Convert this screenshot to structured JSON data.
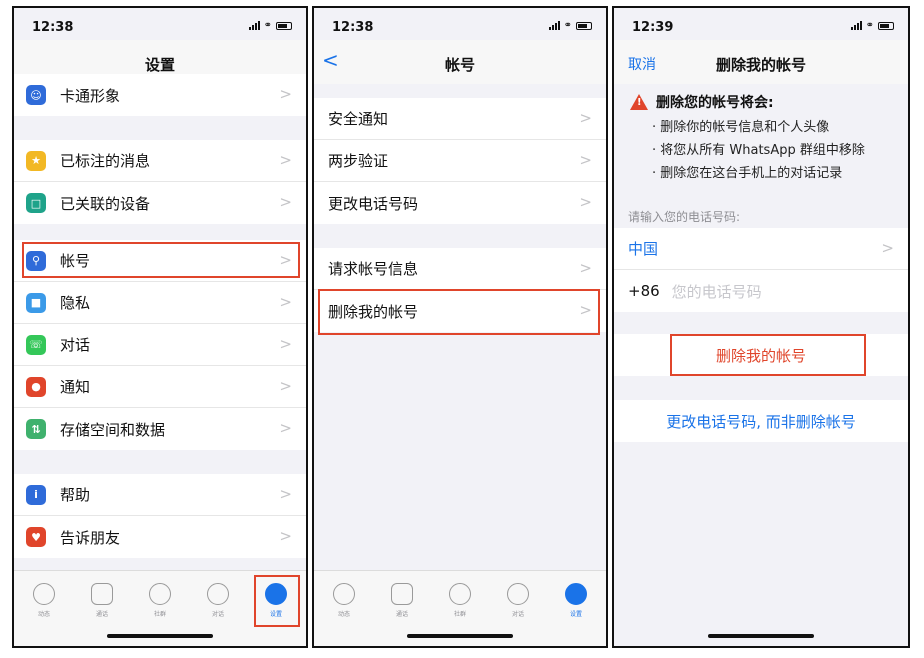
{
  "panel1": {
    "time": "12:38",
    "title": "设置",
    "groups": [
      [
        {
          "label": "卡通形象",
          "icon": "avatar-icon",
          "color": "#2f6bd9"
        }
      ],
      [
        {
          "label": "已标注的消息",
          "icon": "star-icon",
          "color": "#f2b824"
        },
        {
          "label": "已关联的设备",
          "icon": "laptop-icon",
          "color": "#1fa38a"
        }
      ],
      [
        {
          "label": "帐号",
          "icon": "key-icon",
          "color": "#2f6bd9"
        },
        {
          "label": "隐私",
          "icon": "lock-icon",
          "color": "#3b9ae8"
        },
        {
          "label": "对话",
          "icon": "whatsapp-icon",
          "color": "#34c759"
        },
        {
          "label": "通知",
          "icon": "notification-icon",
          "color": "#e0452b"
        },
        {
          "label": "存储空间和数据",
          "icon": "storage-icon",
          "color": "#3fb16d"
        }
      ],
      [
        {
          "label": "帮助",
          "icon": "info-icon",
          "color": "#2f6bd9"
        },
        {
          "label": "告诉朋友",
          "icon": "heart-icon",
          "color": "#e0452b"
        }
      ]
    ],
    "tabs": [
      "动态",
      "通话",
      "社群",
      "对话",
      "设置"
    ]
  },
  "panel2": {
    "time": "12:38",
    "title": "帐号",
    "back": "<",
    "group1": [
      "安全通知",
      "两步验证",
      "更改电话号码"
    ],
    "group2": [
      "请求帐号信息",
      "删除我的帐号"
    ],
    "tabs": [
      "动态",
      "通话",
      "社群",
      "对话",
      "设置"
    ]
  },
  "panel3": {
    "time": "12:39",
    "cancel": "取消",
    "title": "删除我的帐号",
    "warning_title": "删除您的帐号将会:",
    "warning_items": [
      "· 删除你的帐号信息和个人头像",
      "· 将您从所有 WhatsApp 群组中移除",
      "· 删除您在这台手机上的对话记录"
    ],
    "phone_hint": "请输入您的电话号码:",
    "country": "中国",
    "code": "+86",
    "phone_placeholder": "您的电话号码",
    "delete_button": "删除我的帐号",
    "change_number": "更改电话号码, 而非删除帐号"
  },
  "colors": {
    "accent": "#1a73e8",
    "danger": "#e0452b"
  }
}
